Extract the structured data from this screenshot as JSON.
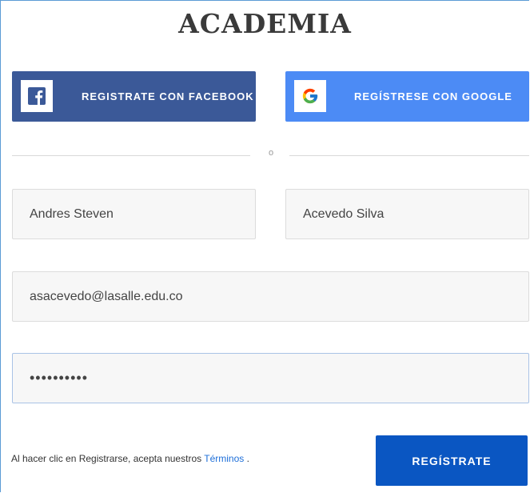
{
  "page": {
    "title": "ACADEMIA"
  },
  "social": {
    "facebook": {
      "label": "REGISTRATE CON FACEBOOK",
      "icon": "facebook-icon",
      "color": "#3b5998"
    },
    "google": {
      "label": "REGÍSTRESE CON GOOGLE",
      "icon": "google-icon",
      "color": "#4c8bf5"
    }
  },
  "divider": {
    "text": "o"
  },
  "form": {
    "first_name": "Andres Steven",
    "last_name": "Acevedo Silva",
    "email": "asacevedo@lasalle.edu.co",
    "password_mask": "••••••••••"
  },
  "footer": {
    "terms_prefix": "Al hacer clic en Registrarse, acepta nuestros ",
    "terms_link": "Términos",
    "terms_suffix": " .",
    "submit_label": "REGÍSTRATE",
    "submit_color": "#0a56c2"
  }
}
